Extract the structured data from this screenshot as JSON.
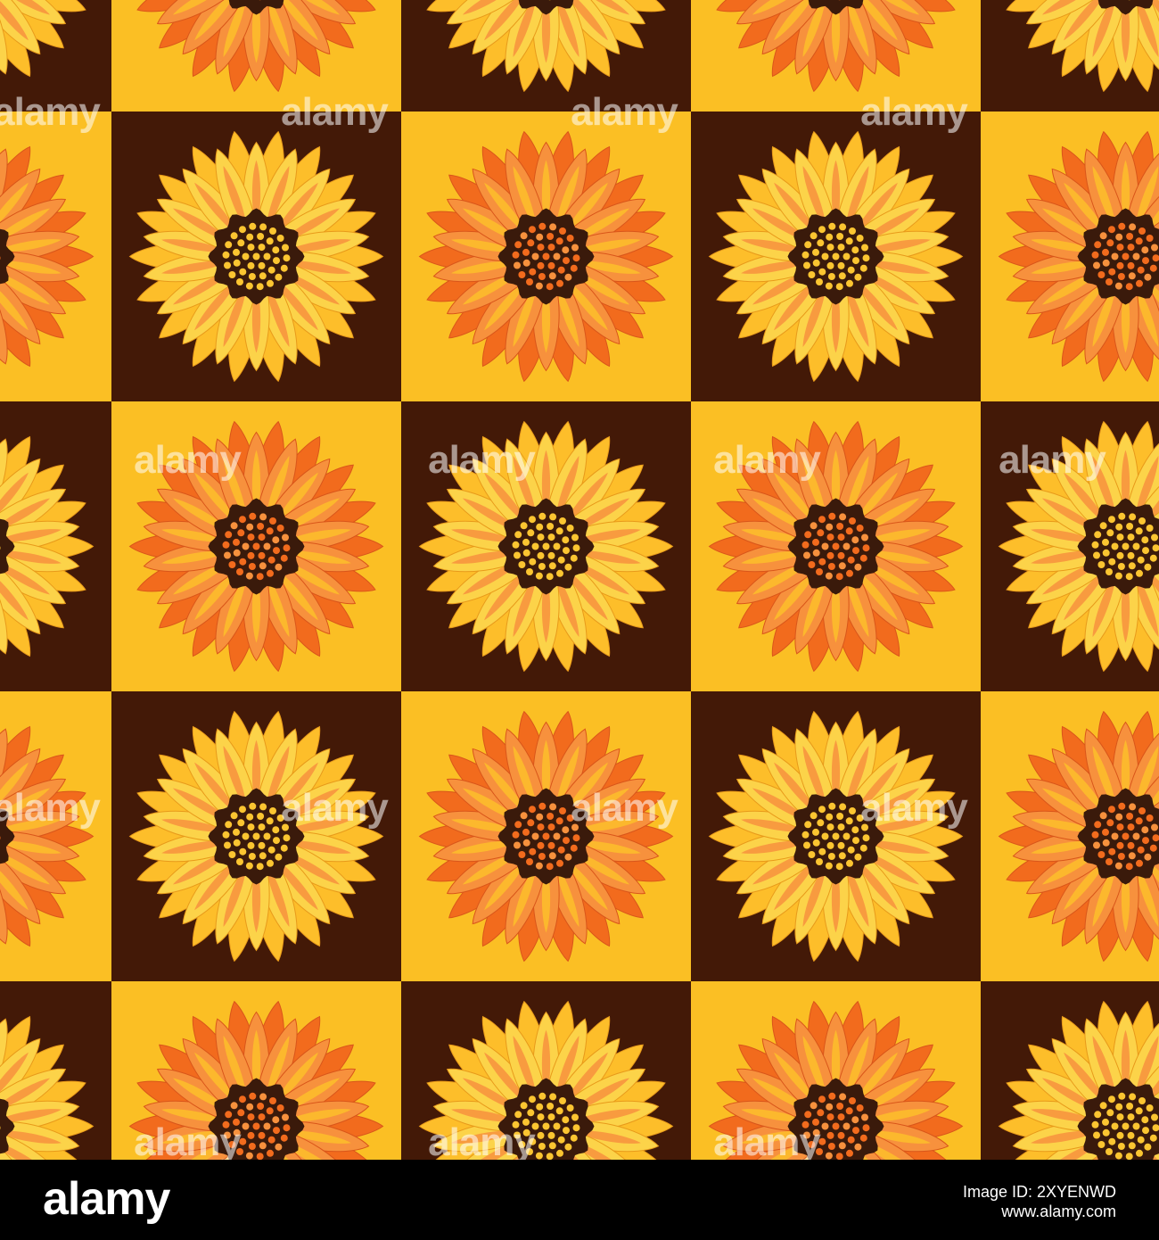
{
  "pattern": {
    "colors": {
      "brown": "#431907",
      "yellow": "#fbbf24",
      "petal_orange": "#f26b1d",
      "petal_orange_light": "#f7913d",
      "petal_yellow": "#fdbe2a",
      "petal_yellow_light": "#fcd349",
      "center_dark": "#3a1a0b",
      "dot_yellow": "#fbc531",
      "dot_orange": "#f26b1d"
    },
    "description": "checkered tiles of dark brown and yellow with sunflower motifs"
  },
  "watermark": {
    "text": "alamy"
  },
  "footer": {
    "logo": "alamy",
    "image_id": "Image ID: 2XYENWD",
    "url": "www.alamy.com"
  }
}
